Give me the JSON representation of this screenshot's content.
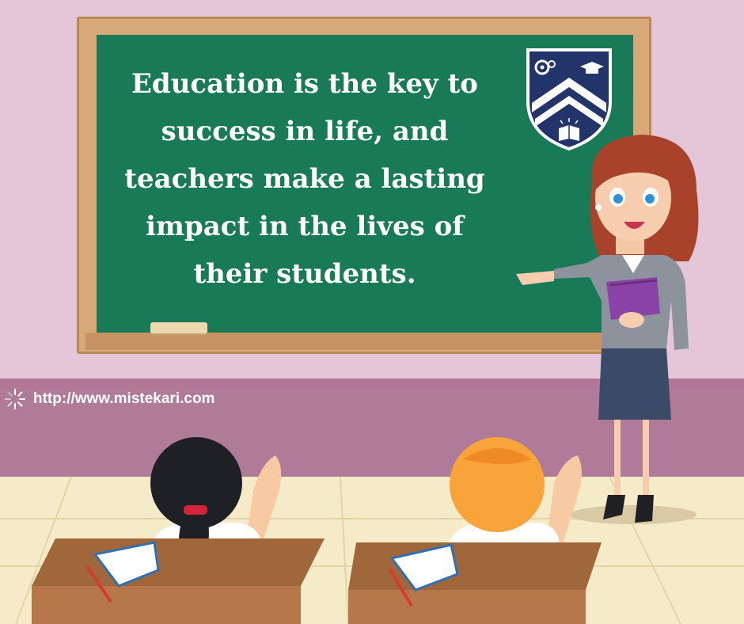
{
  "quote": {
    "lines": [
      "Education is the key to",
      "success in life, and",
      "teachers make a lasting",
      "impact in the lives of",
      "their students."
    ]
  },
  "website": {
    "url": "http://www.mistekari.com",
    "icon": "spinner-icon"
  },
  "emblem": {
    "icons": [
      "gear-icon",
      "graduation-cap-icon",
      "book-icon"
    ]
  },
  "colors": {
    "wall": "#e5c6d9",
    "wainscot": "#b07a99",
    "board": "#187a57",
    "frame": "#d7a978",
    "emblem_navy": "#23346b",
    "jacket": "#8d939c",
    "book_purple": "#8a42a6"
  }
}
